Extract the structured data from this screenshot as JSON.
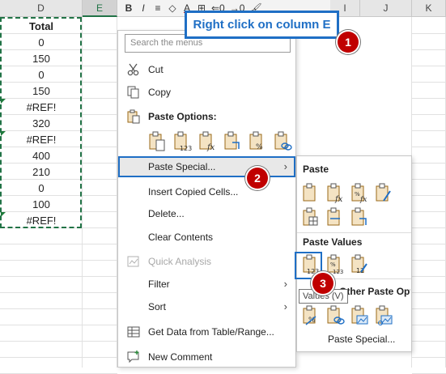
{
  "sheet": {
    "columns": [
      "D",
      "E",
      "I",
      "J",
      "K"
    ],
    "cells": [
      "Total",
      "0",
      "150",
      "0",
      "150",
      "#REF!",
      "320",
      "#REF!",
      "400",
      "210",
      "0",
      "100",
      "#REF!"
    ]
  },
  "ribbon": {
    "buttons": [
      "B",
      "I",
      "≡",
      "◇",
      "A",
      "⊞",
      "⇐0",
      "→0",
      "🖌"
    ]
  },
  "callout": {
    "text": "Right click on column E"
  },
  "badges": [
    "1",
    "2",
    "3"
  ],
  "menu": {
    "search_placeholder": "Search the menus",
    "cut": "Cut",
    "copy": "Copy",
    "paste_options": "Paste Options:",
    "paste_special": "Paste Special...",
    "insert_copied": "Insert Copied Cells...",
    "delete": "Delete...",
    "clear_contents": "Clear Contents",
    "quick_analysis": "Quick Analysis",
    "filter": "Filter",
    "sort": "Sort",
    "get_data": "Get Data from Table/Range...",
    "new_comment": "New Comment",
    "arrow": "›"
  },
  "submenu": {
    "paste": "Paste",
    "paste_values": "Paste Values",
    "other_paste_options": "Other Paste Options",
    "paste_special": "Paste Special...",
    "tooltip": "Values (V)"
  },
  "colors": {
    "accent": "#1f6fc5",
    "badge": "#c00000",
    "excel_green": "#217346"
  }
}
